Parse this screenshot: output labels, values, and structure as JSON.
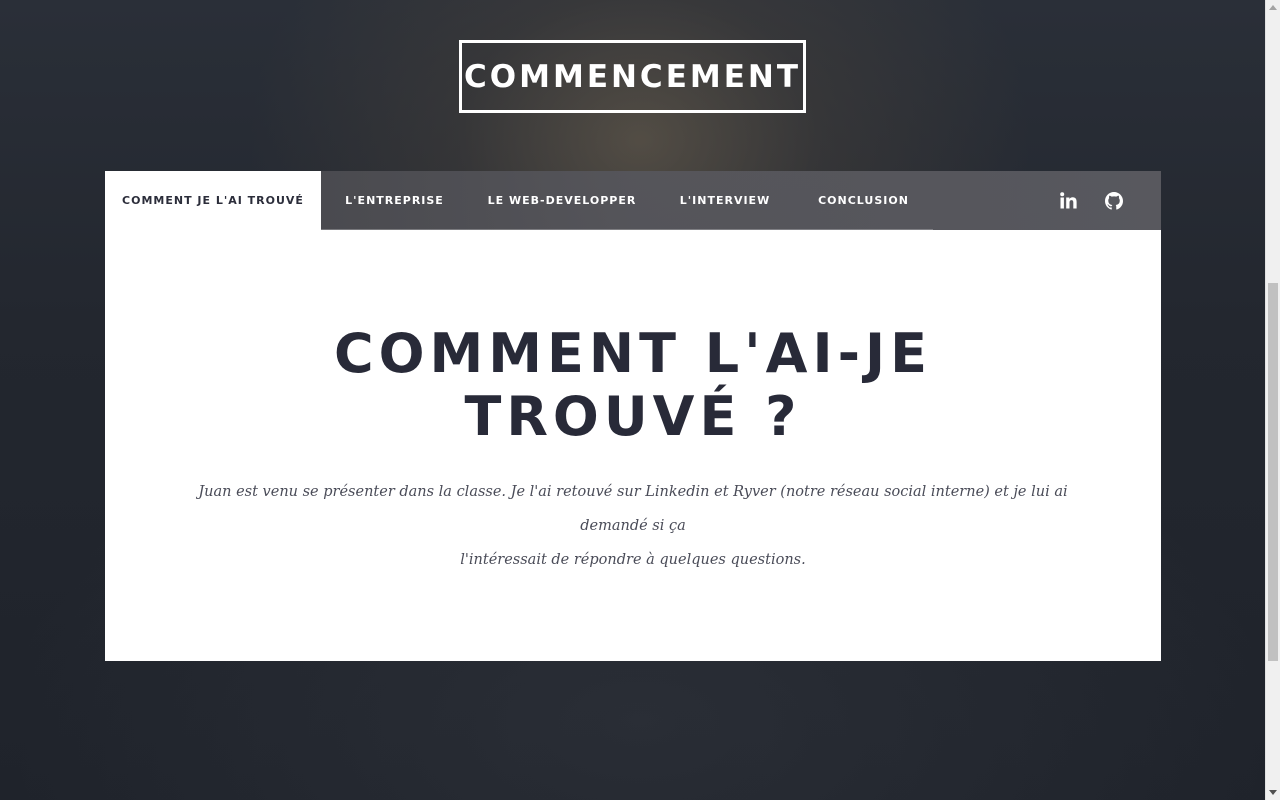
{
  "header": {
    "brand": "COMMENCEMENT"
  },
  "nav": {
    "tabs": [
      {
        "label": "COMMENT JE L'AI TROUVÉ",
        "active": true
      },
      {
        "label": "L'ENTREPRISE",
        "active": false
      },
      {
        "label": "LE WEB-DEVELOPPER",
        "active": false
      },
      {
        "label": "L'INTERVIEW",
        "active": false
      },
      {
        "label": "CONCLUSION",
        "active": false
      }
    ],
    "social": [
      {
        "icon": "linkedin-icon"
      },
      {
        "icon": "github-icon"
      }
    ]
  },
  "section": {
    "title_line1": "COMMENT L'AI-JE",
    "title_line2": "TROUVÉ ?",
    "text_line1": "Juan est venu se présenter dans la classe. Je l'ai retouvé sur Linkedin et Ryver (notre réseau social interne) et je lui ai demandé si ça",
    "text_line2": "l'intéressait de répondre à quelques questions."
  },
  "colors": {
    "accent_dark": "#282a38",
    "nav_bg": "#58585e",
    "card_bg": "#ffffff"
  }
}
